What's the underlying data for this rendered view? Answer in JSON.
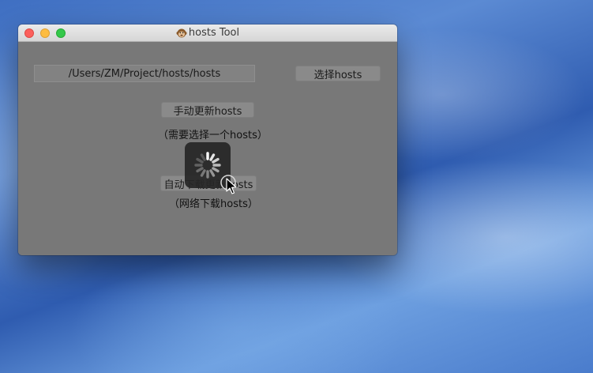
{
  "window": {
    "title": "hosts Tool",
    "title_icon": "monkey-face-icon",
    "controls": [
      "close",
      "minimize",
      "zoom"
    ]
  },
  "main": {
    "path_value": "/Users/ZM/Project/hosts/hosts",
    "choose_button_label": "选择hosts",
    "manual_update_button_label": "手动更新hosts",
    "manual_update_note": "（需要选择一个hosts）",
    "auto_update_button_label": "自动下载更新hosts",
    "auto_update_note": "（网络下载hosts）"
  },
  "overlay": {
    "spinner_icon": "loading-spinner-icon",
    "pointer_icon": "arrow-pointer-icon"
  },
  "colors": {
    "close": "#fc605c",
    "minimize": "#fdbc40",
    "zoom": "#34c84a",
    "content_dimmed": "#787878",
    "hud": "#262626"
  }
}
